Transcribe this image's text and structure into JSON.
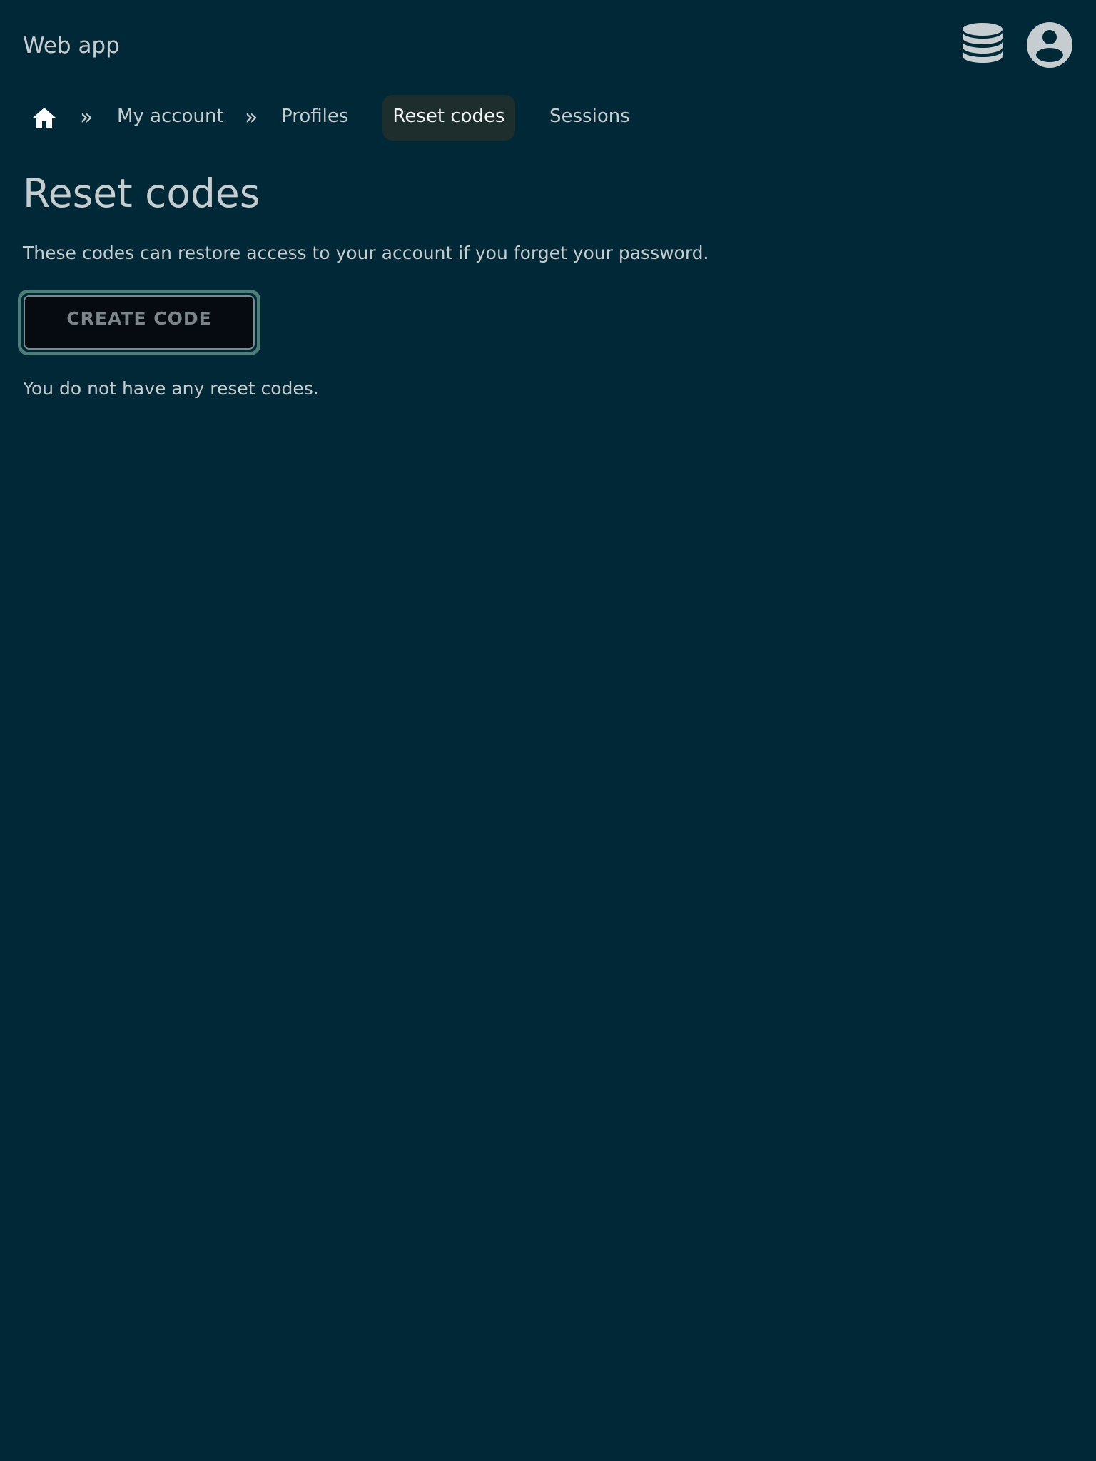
{
  "header": {
    "app_title": "Web app",
    "icons": [
      "database-icon",
      "account-circle-icon"
    ]
  },
  "breadcrumb": {
    "home_icon": "home-icon",
    "separator": "»",
    "items": [
      {
        "label": "My account"
      },
      {
        "label": "Profiles"
      },
      {
        "label": "Reset codes",
        "active": true
      },
      {
        "label": "Sessions"
      }
    ]
  },
  "main": {
    "title": "Reset codes",
    "description": "These codes can restore access to your account if you forget your password.",
    "create_button_label": "CREATE CODE",
    "empty_message": "You do not have any reset codes."
  },
  "colors": {
    "background": "#002836",
    "text": "#c5cdd0",
    "active_crumb_bg": "#1e2e2c",
    "button_bg": "#050b10",
    "focus_ring": "#4e7d7a"
  }
}
